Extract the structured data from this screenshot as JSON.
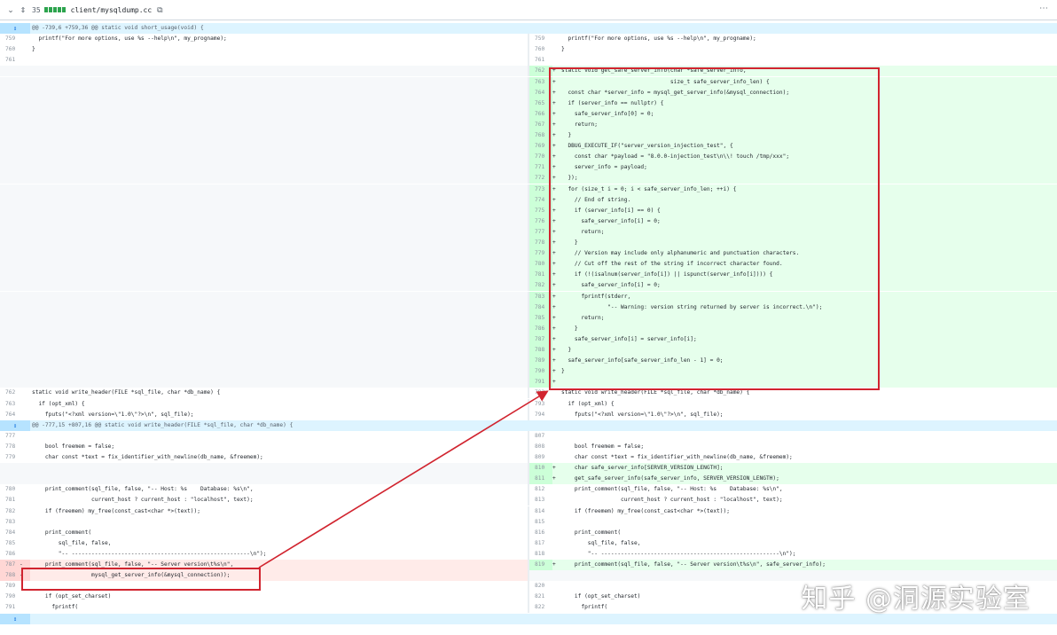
{
  "file_header": {
    "chevron_icon": "chevron-down-icon",
    "expand_icon": "expand-icon",
    "change_count": "35",
    "path": "client/mysqldump.cc",
    "copy_icon": "copy-icon",
    "menu_icon": "kebab-icon"
  },
  "colors": {
    "addition_bg": "#e6ffec",
    "deletion_bg": "#ffebe9",
    "hunk_bg": "#ddf4ff",
    "highlight_box": "#d1242f"
  },
  "rows": [
    {
      "type": "hunk",
      "text": "@@ -739,6 +759,36 @@ static void short_usage(void) {"
    },
    {
      "type": "ctx",
      "l": "759",
      "r": "759",
      "code": "  printf(\"For more options, use %s --help\\n\", my_progname);"
    },
    {
      "type": "ctx",
      "l": "760",
      "r": "760",
      "code": "}"
    },
    {
      "type": "ctx",
      "l": "761",
      "r": "761",
      "code": ""
    },
    {
      "type": "add",
      "l": "",
      "r": "762",
      "code": "static void get_safe_server_info(char *safe_server_info,"
    },
    {
      "type": "add",
      "l": "",
      "r": "763",
      "code": "                                 size_t safe_server_info_len) {"
    },
    {
      "type": "add",
      "l": "",
      "r": "764",
      "code": "  const char *server_info = mysql_get_server_info(&mysql_connection);"
    },
    {
      "type": "add",
      "l": "",
      "r": "765",
      "code": "  if (server_info == nullptr) {"
    },
    {
      "type": "add",
      "l": "",
      "r": "766",
      "code": "    safe_server_info[0] = 0;"
    },
    {
      "type": "add",
      "l": "",
      "r": "767",
      "code": "    return;"
    },
    {
      "type": "add",
      "l": "",
      "r": "768",
      "code": "  }"
    },
    {
      "type": "add",
      "l": "",
      "r": "769",
      "code": "  DBUG_EXECUTE_IF(\"server_version_injection_test\", {"
    },
    {
      "type": "add",
      "l": "",
      "r": "770",
      "code": "    const char *payload = \"8.0.0-injection_test\\n\\\\! touch /tmp/xxx\";"
    },
    {
      "type": "add",
      "l": "",
      "r": "771",
      "code": "    server_info = payload;"
    },
    {
      "type": "add",
      "l": "",
      "r": "772",
      "code": "  });"
    },
    {
      "type": "add",
      "l": "",
      "r": "773",
      "code": "  for (size_t i = 0; i < safe_server_info_len; ++i) {"
    },
    {
      "type": "add",
      "l": "",
      "r": "774",
      "code": "    // End of string."
    },
    {
      "type": "add",
      "l": "",
      "r": "775",
      "code": "    if (server_info[i] == 0) {"
    },
    {
      "type": "add",
      "l": "",
      "r": "776",
      "code": "      safe_server_info[i] = 0;"
    },
    {
      "type": "add",
      "l": "",
      "r": "777",
      "code": "      return;"
    },
    {
      "type": "add",
      "l": "",
      "r": "778",
      "code": "    }"
    },
    {
      "type": "add",
      "l": "",
      "r": "779",
      "code": "    // Version may include only alphanumeric and punctuation characters."
    },
    {
      "type": "add",
      "l": "",
      "r": "780",
      "code": "    // Cut off the rest of the string if incorrect character found."
    },
    {
      "type": "add",
      "l": "",
      "r": "781",
      "code": "    if (!(isalnum(server_info[i]) || ispunct(server_info[i]))) {"
    },
    {
      "type": "add",
      "l": "",
      "r": "782",
      "code": "      safe_server_info[i] = 0;"
    },
    {
      "type": "add",
      "l": "",
      "r": "783",
      "code": "      fprintf(stderr,"
    },
    {
      "type": "add",
      "l": "",
      "r": "784",
      "code": "              \"-- Warning: version string returned by server is incorrect.\\n\");"
    },
    {
      "type": "add",
      "l": "",
      "r": "785",
      "code": "      return;"
    },
    {
      "type": "add",
      "l": "",
      "r": "786",
      "code": "    }"
    },
    {
      "type": "add",
      "l": "",
      "r": "787",
      "code": "    safe_server_info[i] = server_info[i];"
    },
    {
      "type": "add",
      "l": "",
      "r": "788",
      "code": "  }"
    },
    {
      "type": "add",
      "l": "",
      "r": "789",
      "code": "  safe_server_info[safe_server_info_len - 1] = 0;"
    },
    {
      "type": "add",
      "l": "",
      "r": "790",
      "code": "}"
    },
    {
      "type": "add",
      "l": "",
      "r": "791",
      "code": ""
    },
    {
      "type": "ctx",
      "l": "762",
      "r": "792",
      "code": "static void write_header(FILE *sql_file, char *db_name) {"
    },
    {
      "type": "ctx",
      "l": "763",
      "r": "793",
      "code": "  if (opt_xml) {"
    },
    {
      "type": "ctx",
      "l": "764",
      "r": "794",
      "code": "    fputs(\"<?xml version=\\\"1.0\\\"?>\\n\", sql_file);"
    },
    {
      "type": "hunk",
      "text": "@@ -777,15 +807,16 @@ static void write_header(FILE *sql_file, char *db_name) {"
    },
    {
      "type": "ctx",
      "l": "777",
      "r": "807",
      "code": ""
    },
    {
      "type": "ctx",
      "l": "778",
      "r": "808",
      "code": "    bool freemem = false;"
    },
    {
      "type": "ctx",
      "l": "779",
      "r": "809",
      "code": "    char const *text = fix_identifier_with_newline(db_name, &freemem);"
    },
    {
      "type": "add",
      "l": "",
      "r": "810",
      "code": "    char safe_server_info[SERVER_VERSION_LENGTH];"
    },
    {
      "type": "add",
      "l": "",
      "r": "811",
      "code": "    get_safe_server_info(safe_server_info, SERVER_VERSION_LENGTH);"
    },
    {
      "type": "ctx",
      "l": "780",
      "r": "812",
      "code": "    print_comment(sql_file, false, \"-- Host: %s    Database: %s\\n\","
    },
    {
      "type": "ctx",
      "l": "781",
      "r": "813",
      "code": "                  current_host ? current_host : \"localhost\", text);"
    },
    {
      "type": "ctx",
      "l": "782",
      "r": "814",
      "code": "    if (freemem) my_free(const_cast<char *>(text));"
    },
    {
      "type": "ctx",
      "l": "783",
      "r": "815",
      "code": ""
    },
    {
      "type": "ctx",
      "l": "784",
      "r": "816",
      "code": "    print_comment("
    },
    {
      "type": "ctx",
      "l": "785",
      "r": "817",
      "code": "        sql_file, false,"
    },
    {
      "type": "ctx",
      "l": "786",
      "r": "818",
      "code": "        \"-- ------------------------------------------------------\\n\");"
    },
    {
      "type": "mod",
      "l": "787",
      "r": "819",
      "lsign": "-",
      "rsign": "+",
      "lcode": "    print_comment(sql_file, false, \"-- Server version\\t%s\\n\",",
      "rcode": "    print_comment(sql_file, false, \"-- Server version\\t%s\\n\", safe_server_info);"
    },
    {
      "type": "del",
      "l": "788",
      "r": "",
      "lsign": "-",
      "code": "                  mysql_get_server_info(&mysql_connection));"
    },
    {
      "type": "ctx",
      "l": "789",
      "r": "820",
      "code": ""
    },
    {
      "type": "ctx",
      "l": "790",
      "r": "821",
      "code": "    if (opt_set_charset)"
    },
    {
      "type": "ctx",
      "l": "791",
      "r": "822",
      "code": "      fprintf("
    },
    {
      "type": "hunk",
      "text": ""
    }
  ],
  "watermark": "知乎 @洞源实验室"
}
